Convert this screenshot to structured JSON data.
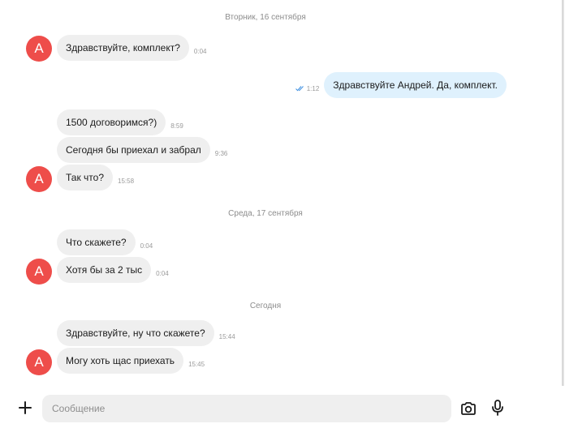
{
  "dates": [
    "Вторник, 16 сентября",
    "Среда, 17 сентября",
    "Сегодня"
  ],
  "avatar_letter": "А",
  "messages": [
    {
      "text": "Здравствуйте, комплект?",
      "time": "0:04"
    },
    {
      "text": "Здравствуйте Андрей. Да, комплект.",
      "time": "1:12"
    },
    {
      "text": "1500 договоримся?)",
      "time": "8:59"
    },
    {
      "text": "Сегодня бы приехал и забрал",
      "time": "9:36"
    },
    {
      "text": "Так что?",
      "time": "15:58"
    },
    {
      "text": "Что скажете?",
      "time": "0:04"
    },
    {
      "text": "Хотя бы за 2 тыс",
      "time": "0:04"
    },
    {
      "text": "Здравствуйте, ну что скажете?",
      "time": "15:44"
    },
    {
      "text": "Могу хоть щас приехать",
      "time": "15:45"
    }
  ],
  "composer": {
    "placeholder": "Сообщение"
  },
  "colors": {
    "avatar": "#ee4d4a",
    "incoming_bubble": "#efefef",
    "outgoing_bubble": "#dff1fd",
    "read_check": "#3d8fe0"
  }
}
